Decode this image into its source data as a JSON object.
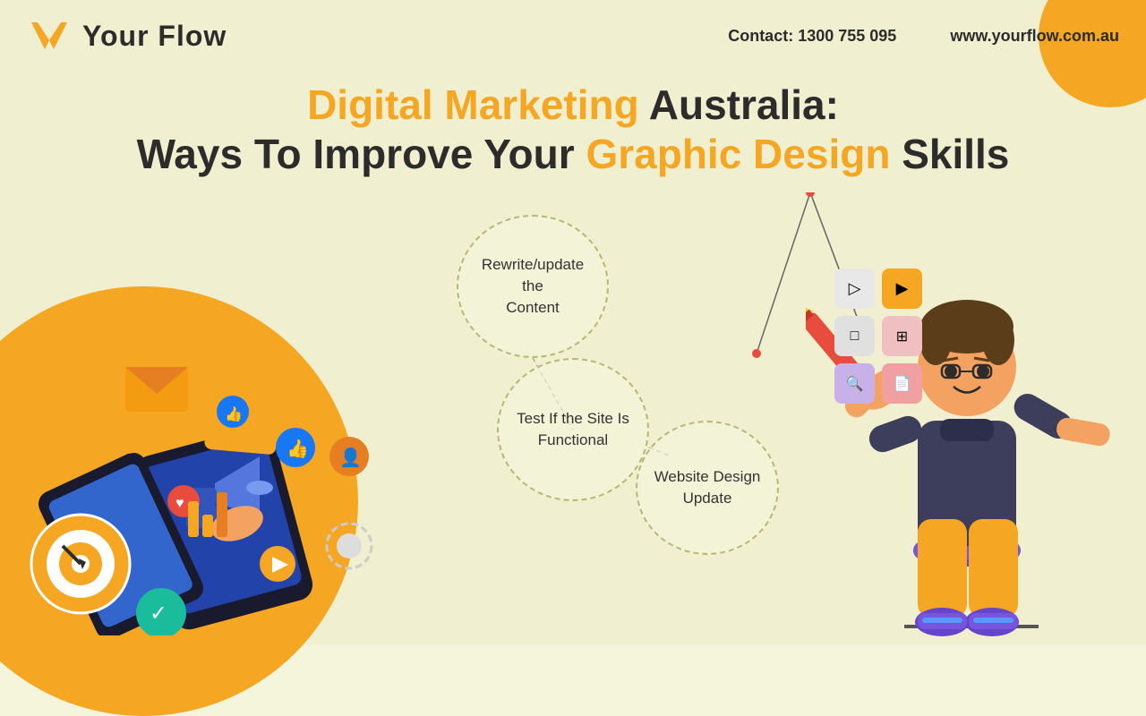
{
  "brand": {
    "logo_text": "Your Flow",
    "logo_icon": "V-check",
    "contact": "Contact: 1300 755 095",
    "website": "www.yourflow.com.au"
  },
  "header": {
    "contact_label": "Contact: 1300 755 095",
    "website_label": "www.yourflow.com.au"
  },
  "title": {
    "line1_part1": "Digital Marketing",
    "line1_part2": " Australia:",
    "line2_part1": "Ways To Improve Your ",
    "line2_part2": "Graphic Design",
    "line2_part3": " Skills"
  },
  "bubbles": [
    {
      "id": "bubble-1",
      "text": "Rewrite/update\nthe\nContent"
    },
    {
      "id": "bubble-2",
      "text": "Test If the Site Is\nFunctional"
    },
    {
      "id": "bubble-3",
      "text": "Website Design\nUpdate"
    }
  ],
  "colors": {
    "orange": "#f5a623",
    "dark": "#2c2c2c",
    "bg": "#f0f0d0",
    "bubble_border": "#c8c8a0"
  },
  "design_tools": [
    {
      "label": "cursor-arrow-icon",
      "bg": "#e8e8e8",
      "symbol": "▷"
    },
    {
      "label": "cursor-fill-icon",
      "bg": "#f5a623",
      "symbol": "▶"
    },
    {
      "label": "square-icon",
      "bg": "#e8e8e8",
      "symbol": "□"
    },
    {
      "label": "link-icon",
      "bg": "#e8c0c0",
      "symbol": "⊕"
    },
    {
      "label": "search-icon",
      "bg": "#c0b0e8",
      "symbol": "🔍"
    },
    {
      "label": "doc-icon",
      "bg": "#e8b0b0",
      "symbol": "📄"
    }
  ]
}
